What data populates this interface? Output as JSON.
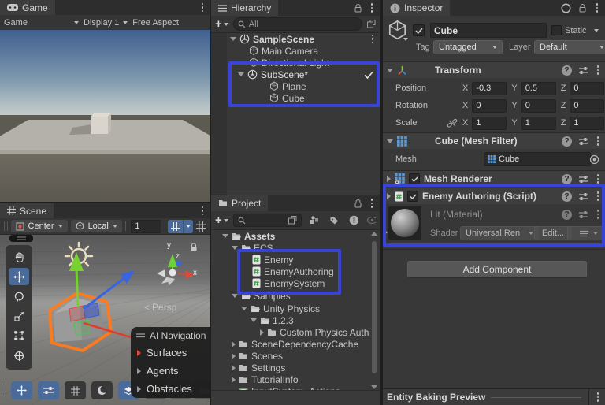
{
  "glyphs": {
    "help": "?",
    "plus": "+",
    "lt": "<"
  },
  "game_panel": {
    "tab_label": "Game",
    "toolbar": {
      "view": "Game",
      "display": "Display 1",
      "aspect": "Free Aspect"
    }
  },
  "scene_panel": {
    "tab_label": "Scene",
    "toolbar": {
      "pivot": "Center",
      "orientation": "Local",
      "grid_value": "1"
    },
    "gizmo": {
      "x": "x",
      "y": "y",
      "z": "z",
      "persp": "Persp"
    },
    "nav_overlay": {
      "title": "AI Navigation",
      "items": [
        {
          "label": "Surfaces"
        },
        {
          "label": "Agents"
        },
        {
          "label": "Obstacles"
        }
      ]
    }
  },
  "hierarchy_panel": {
    "tab_label": "Hierarchy",
    "search_value": "All",
    "items": [
      {
        "label": "SampleScene"
      },
      {
        "label": "Main Camera"
      },
      {
        "label": "Directional Light"
      },
      {
        "label": "SubScene*"
      },
      {
        "label": "Plane"
      },
      {
        "label": "Cube"
      }
    ]
  },
  "project_panel": {
    "tab_label": "Project",
    "items": [
      {
        "label": "Assets"
      },
      {
        "label": "ECS"
      },
      {
        "label": "Enemy"
      },
      {
        "label": "EnemyAuthoring"
      },
      {
        "label": "EnemySystem"
      },
      {
        "label": "Samples"
      },
      {
        "label": "Unity Physics"
      },
      {
        "label": "1.2.3"
      },
      {
        "label": "Custom Physics Auth"
      },
      {
        "label": "SceneDependencyCache"
      },
      {
        "label": "Scenes"
      },
      {
        "label": "Settings"
      },
      {
        "label": "TutorialInfo"
      },
      {
        "label": "InputSystem_Actions"
      }
    ]
  },
  "inspector_panel": {
    "tab_label": "Inspector",
    "header": {
      "name_value": "Cube",
      "static_label": "Static",
      "tag_label": "Tag",
      "tag_value": "Untagged",
      "layer_label": "Layer",
      "layer_value": "Default"
    },
    "axis": {
      "x": "X",
      "y": "Y",
      "z": "Z"
    },
    "transform": {
      "title": "Transform",
      "position": {
        "label": "Position",
        "x": "-0.3",
        "y": "0.5",
        "z": "0"
      },
      "rotation": {
        "label": "Rotation",
        "x": "0",
        "y": "0",
        "z": "0"
      },
      "scale": {
        "label": "Scale",
        "x": "1",
        "y": "1",
        "z": "1"
      }
    },
    "mesh_filter": {
      "title": "Cube (Mesh Filter)",
      "mesh_label": "Mesh",
      "mesh_value": "Cube"
    },
    "mesh_renderer": {
      "title": "Mesh Renderer"
    },
    "enemy_authoring": {
      "title": "Enemy Authoring (Script)"
    },
    "material": {
      "title": "Lit (Material)",
      "shader_label": "Shader",
      "shader_value": "Universal Ren",
      "edit_label": "Edit..."
    },
    "add_component_label": "Add Component",
    "entity_baking_label": "Entity Baking Preview"
  }
}
